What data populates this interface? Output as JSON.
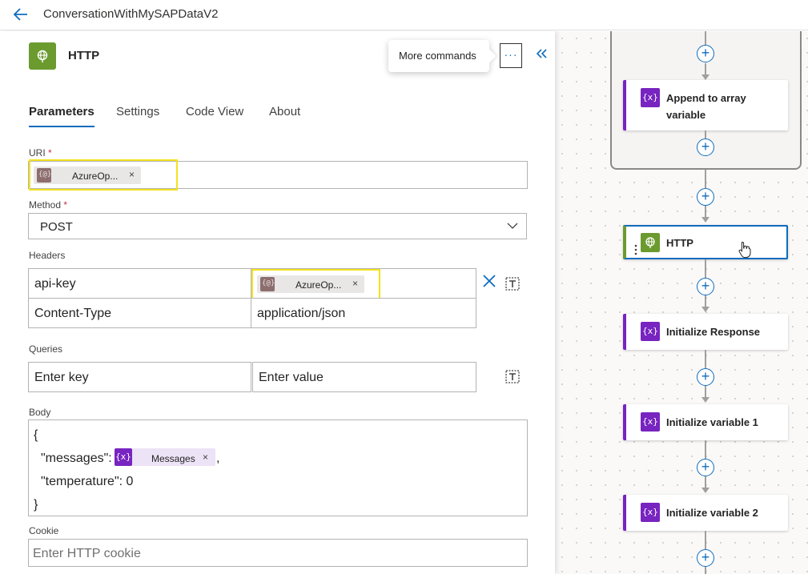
{
  "header": {
    "title": "ConversationWithMySAPDataV2"
  },
  "panel": {
    "action_title": "HTTP",
    "more_commands_tooltip": "More commands",
    "more_commands_glyph": "···",
    "tabs": [
      {
        "label": "Parameters",
        "active": true
      },
      {
        "label": "Settings",
        "active": false
      },
      {
        "label": "Code View",
        "active": false
      },
      {
        "label": "About",
        "active": false
      }
    ],
    "uri": {
      "label": "URI",
      "required": "*",
      "token_label": "AzureOp...",
      "token_icon": "{@}"
    },
    "method": {
      "label": "Method",
      "required": "*",
      "value": "POST"
    },
    "headers": {
      "label": "Headers",
      "rows": [
        {
          "key": "api-key",
          "value_token": "AzureOp...",
          "value": ""
        },
        {
          "key": "Content-Type",
          "value": "application/json"
        }
      ]
    },
    "queries": {
      "label": "Queries",
      "key_placeholder": "Enter key",
      "value_placeholder": "Enter value"
    },
    "body": {
      "label": "Body",
      "lines": [
        "{",
        "\"messages\":",
        "\"temperature\": 0",
        "}"
      ],
      "token_label": "Messages",
      "token_icon": "{x}",
      "after_token": ","
    },
    "cookie": {
      "label": "Cookie",
      "placeholder": "Enter HTTP cookie"
    },
    "token_remove_glyph": "×"
  },
  "canvas": {
    "plus_glyph": "+",
    "cards": [
      {
        "label": "Append to array variable",
        "icon": "{x}"
      },
      {
        "label": "HTTP",
        "icon": "globe-icon",
        "selected": true
      },
      {
        "label": "Initialize Response",
        "icon": "{x}"
      },
      {
        "label": "Initialize variable 1",
        "icon": "{x}"
      },
      {
        "label": "Initialize variable 2",
        "icon": "{x}"
      }
    ]
  },
  "colors": {
    "accent": "#0f6cbd",
    "variable": "#7724c1",
    "http": "#6b9b2f",
    "highlight": "#f3e21e",
    "token": "#8c6e6e"
  }
}
